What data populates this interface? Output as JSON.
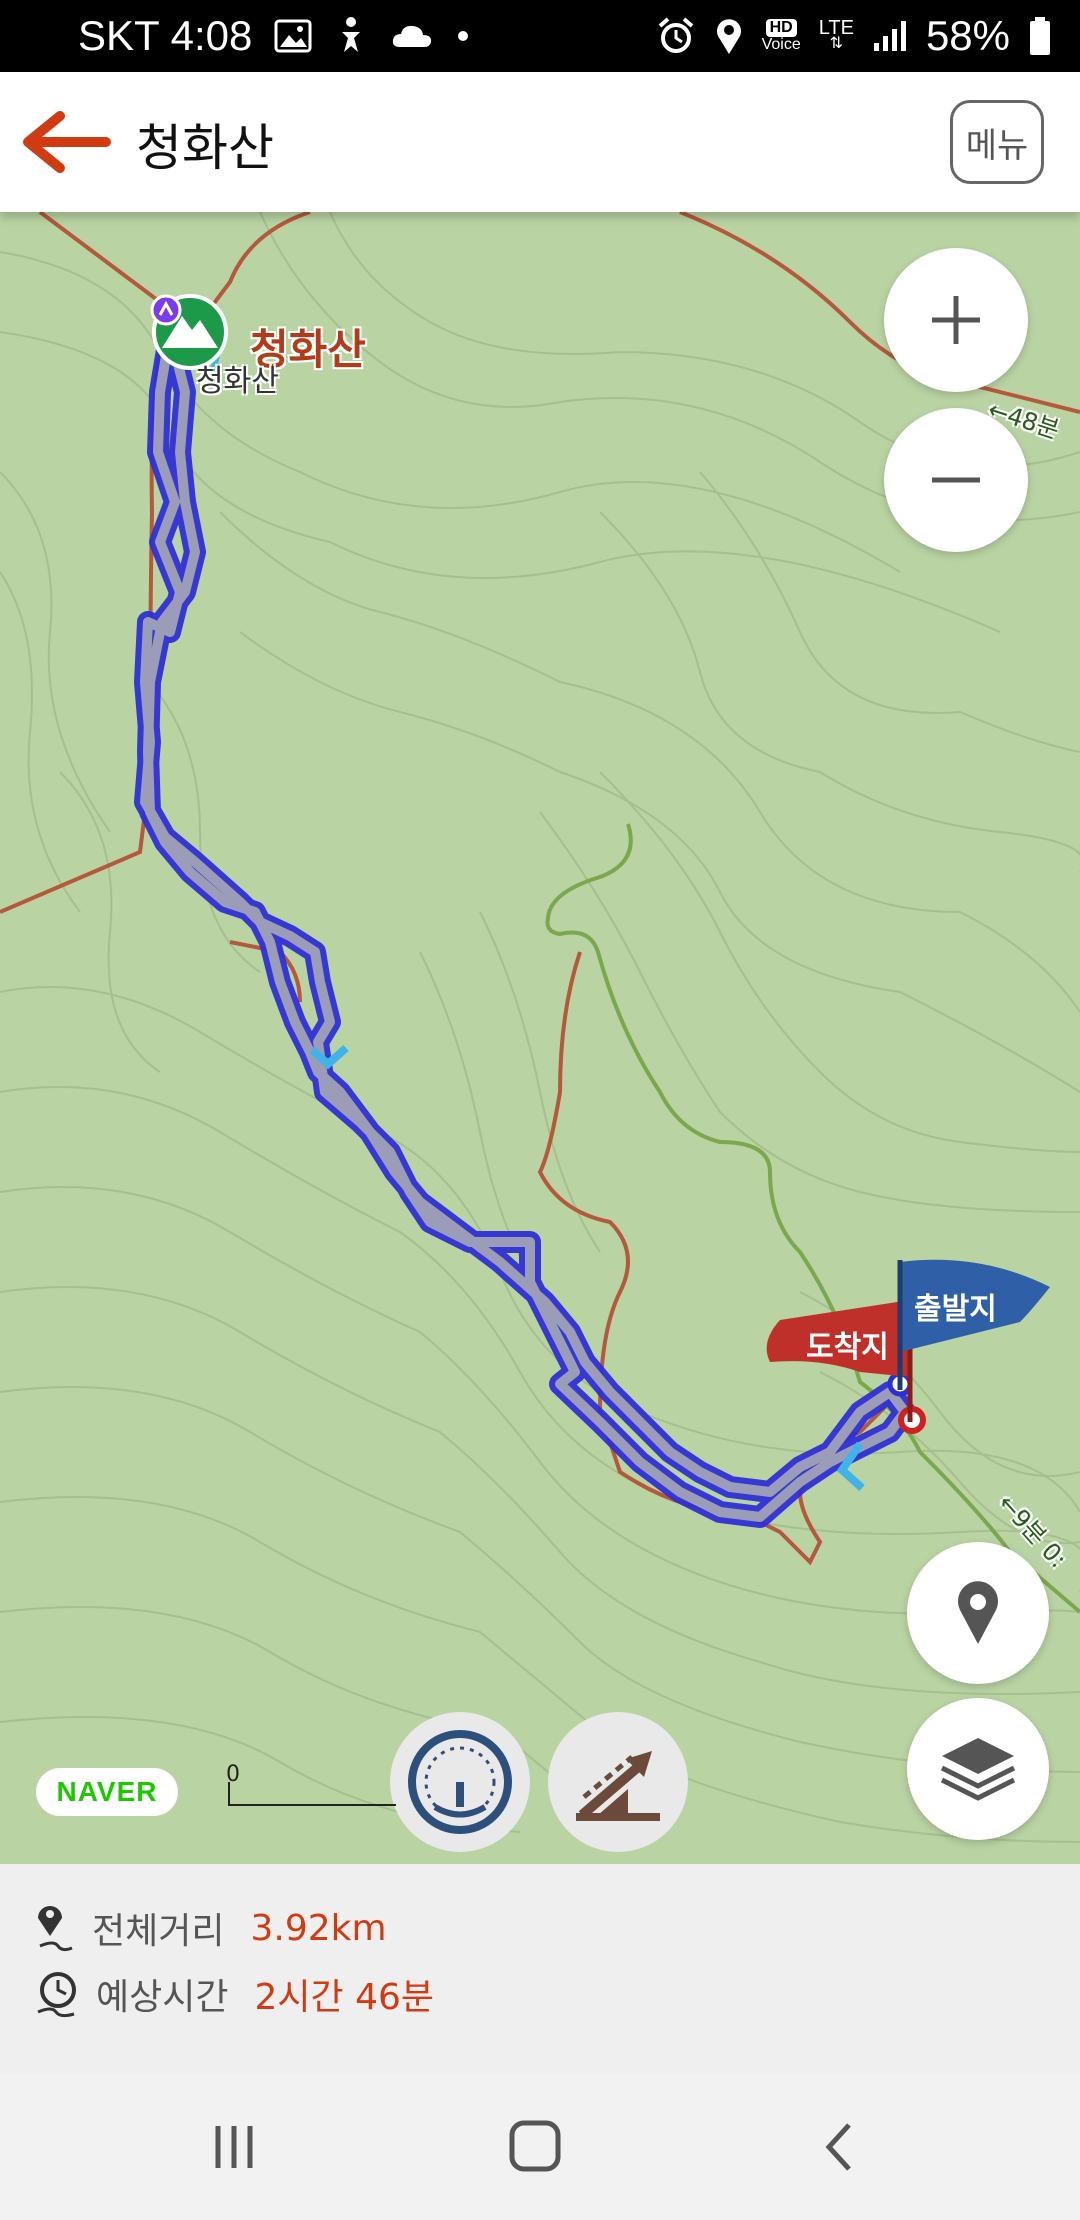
{
  "status_bar": {
    "carrier_time": "SKT 4:08",
    "hd_label": "HD",
    "voice_label": "Voice",
    "lte_label": "LTE",
    "battery": "58%"
  },
  "header": {
    "title": "청화산",
    "menu_label": "메뉴"
  },
  "map": {
    "peak_name": "청화산",
    "peak_sub_label": "청화산",
    "start_flag": "출발지",
    "end_flag": "도착지",
    "trail_time_top": "←48분",
    "trail_time_bottom": "←9분 0:",
    "naver_logo": "NAVER",
    "scale_zero": "0"
  },
  "summary": {
    "distance_label": "전체거리",
    "distance_value": "3.92km",
    "time_label": "예상시간",
    "time_value": "2시간 46분"
  },
  "colors": {
    "accent": "#d13b12",
    "route": "#2d2fd6",
    "map_bg": "#b9d3a3"
  }
}
